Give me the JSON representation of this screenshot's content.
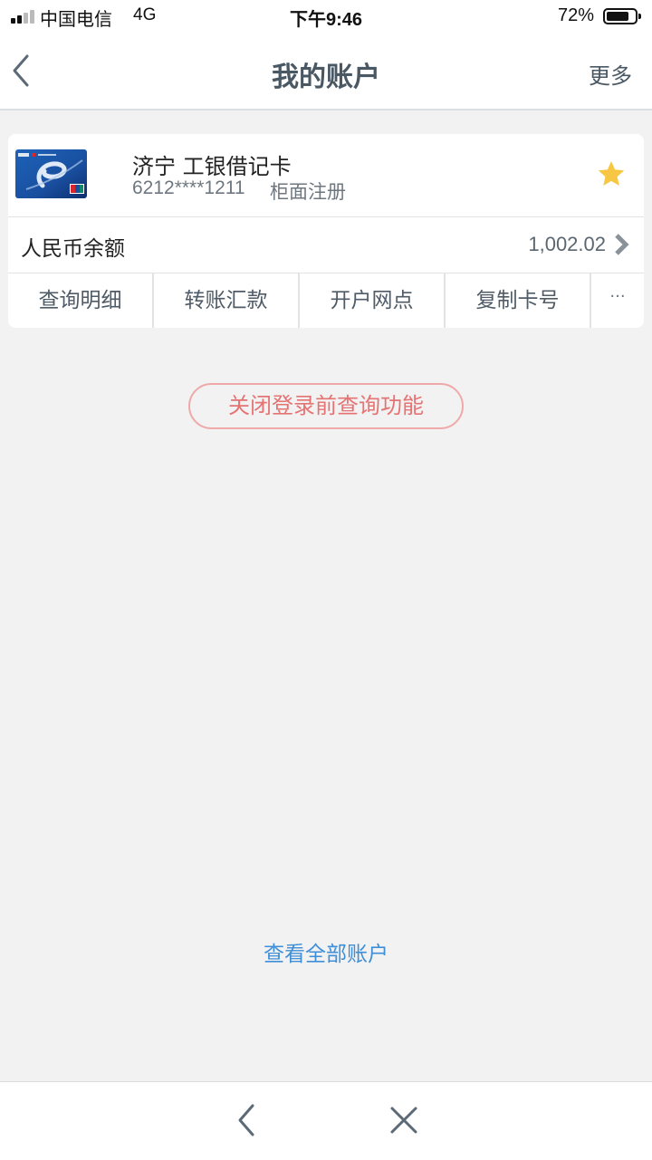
{
  "status_bar": {
    "carrier": "中国电信",
    "network": "4G",
    "time": "下午9:46",
    "battery_percent": "72%",
    "battery_level": 0.72
  },
  "nav": {
    "title": "我的账户",
    "more_label": "更多",
    "back_icon": "chevron-left-icon"
  },
  "card": {
    "name": "济宁 工银借记卡",
    "number": "6212****1211",
    "registration": "柜面注册",
    "favorite_icon": "star-icon",
    "favorite_color": "#f7c744",
    "balance_label": "人民币余额",
    "balance_value": "1,002.02",
    "actions": [
      {
        "label": "查询明细"
      },
      {
        "label": "转账汇款"
      },
      {
        "label": "开户网点"
      },
      {
        "label": "复制卡号"
      },
      {
        "label": "···"
      }
    ]
  },
  "close_query_button": "关闭登录前查询功能",
  "view_all_link": "查看全部账户",
  "colors": {
    "background": "#f2f2f2",
    "link": "#3f8fd8",
    "pill_text": "#e57373",
    "pill_border": "#f0a9a9",
    "nav_text": "#4a5864"
  }
}
